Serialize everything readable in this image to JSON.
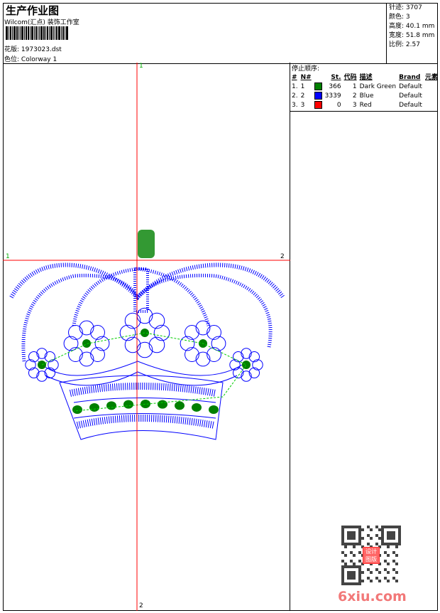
{
  "header": {
    "title": "生产作业图",
    "company": "Wilcom(汇点) 装饰工作室",
    "design_label": "花版:",
    "design_value": "1973023.dst",
    "colorway_label": "色位:",
    "colorway_value": "Colorway 1"
  },
  "stats": [
    {
      "label": "针迹:",
      "value": "3707"
    },
    {
      "label": "颜色:",
      "value": "3"
    },
    {
      "label": "高度:",
      "value": "40.1 mm"
    },
    {
      "label": "宽度:",
      "value": "51.8 mm"
    },
    {
      "label": "比例:",
      "value": "2.57"
    }
  ],
  "stop_sequence": {
    "title": "停止顺序:",
    "headers": [
      "#",
      "N#",
      "St.",
      "代码",
      "描述",
      "Brand",
      "元素"
    ],
    "rows": [
      {
        "idx": "1.",
        "n": "1",
        "color": "#008000",
        "st": "366",
        "code": "1",
        "desc": "Dark Green",
        "brand": "Default"
      },
      {
        "idx": "2.",
        "n": "2",
        "color": "#0000ff",
        "st": "3339",
        "code": "2",
        "desc": "Blue",
        "brand": "Default"
      },
      {
        "idx": "3.",
        "n": "3",
        "color": "#ff0000",
        "st": "0",
        "code": "3",
        "desc": "Red",
        "brand": "Default"
      }
    ]
  },
  "axes": {
    "top": "1",
    "left": "1",
    "right": "2",
    "bottom": "2"
  },
  "watermark": {
    "text": "6xiu.com",
    "seal": "设计图版"
  },
  "colors": {
    "crosshair": "#ff0000",
    "stitch_blue": "#0000ff",
    "stitch_green": "#008000"
  }
}
